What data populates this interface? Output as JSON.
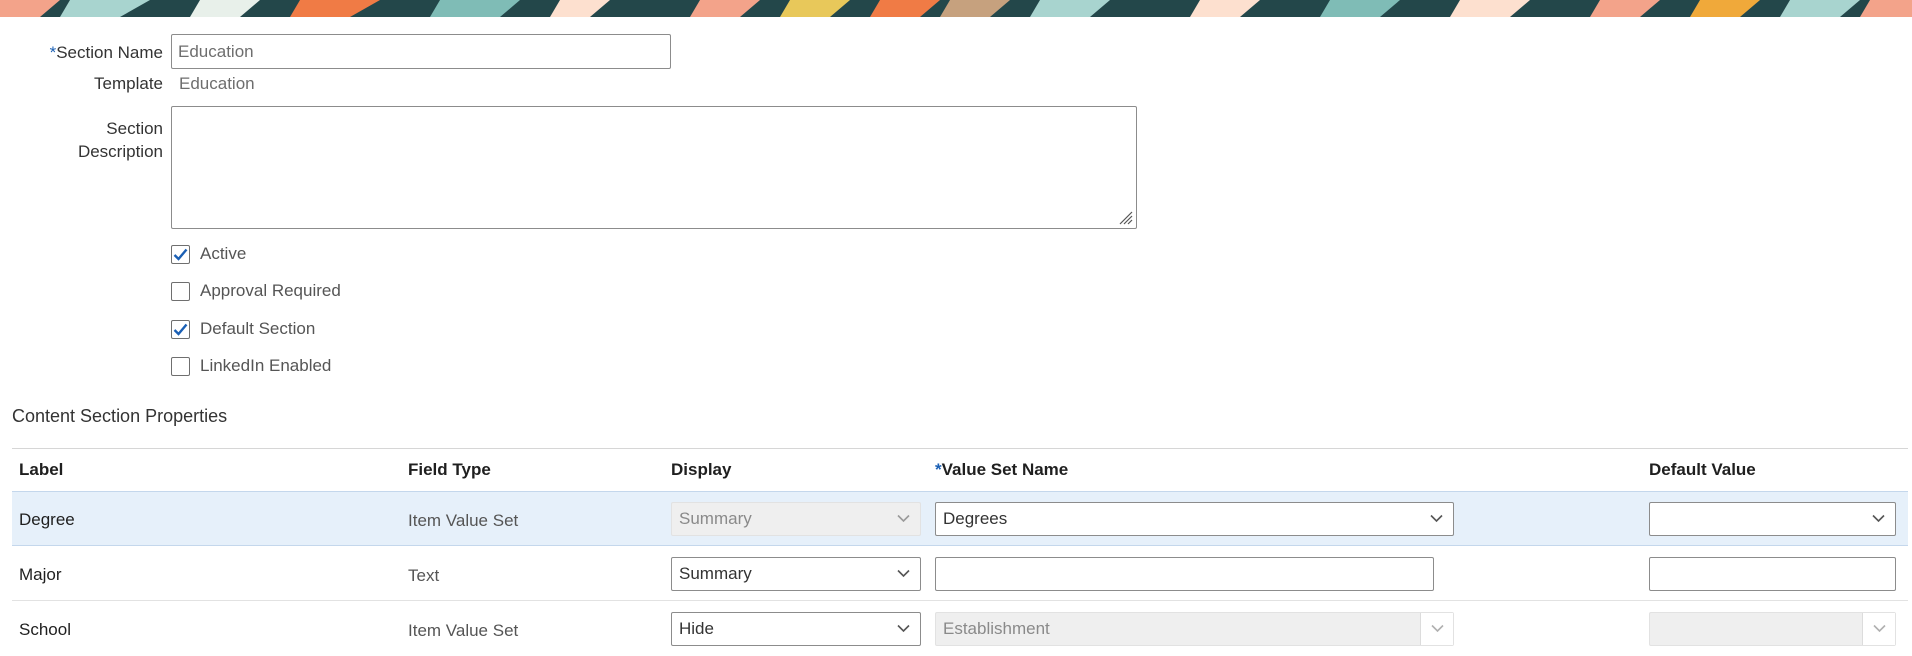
{
  "form": {
    "section_name": {
      "label": "Section Name",
      "required_mark": "*",
      "value": "Education"
    },
    "template": {
      "label": "Template",
      "value": "Education"
    },
    "section_description": {
      "label_line1": "Section",
      "label_line2": "Description",
      "value": ""
    },
    "checkboxes": [
      {
        "label": "Active",
        "checked": true
      },
      {
        "label": "Approval Required",
        "checked": false
      },
      {
        "label": "Default Section",
        "checked": true
      },
      {
        "label": "LinkedIn Enabled",
        "checked": false
      }
    ]
  },
  "content_section": {
    "title": "Content Section Properties",
    "columns": {
      "label": "Label",
      "field_type": "Field Type",
      "display": "Display",
      "value_set_required_mark": "*",
      "value_set_name": "Value Set Name",
      "default_value": "Default Value"
    },
    "rows": [
      {
        "label": "Degree",
        "field_type": "Item Value Set",
        "display": "Summary",
        "value_set": "Degrees",
        "default_value": ""
      },
      {
        "label": "Major",
        "field_type": "Text",
        "display": "Summary",
        "value_set": "",
        "default_value": ""
      },
      {
        "label": "School",
        "field_type": "Item Value Set",
        "display": "Hide",
        "value_set": "Establishment",
        "default_value": ""
      }
    ]
  },
  "colors": {
    "accent": "#1a5fb4",
    "selected_row": "#e6f0fa",
    "disabled_field": "#efefef"
  }
}
